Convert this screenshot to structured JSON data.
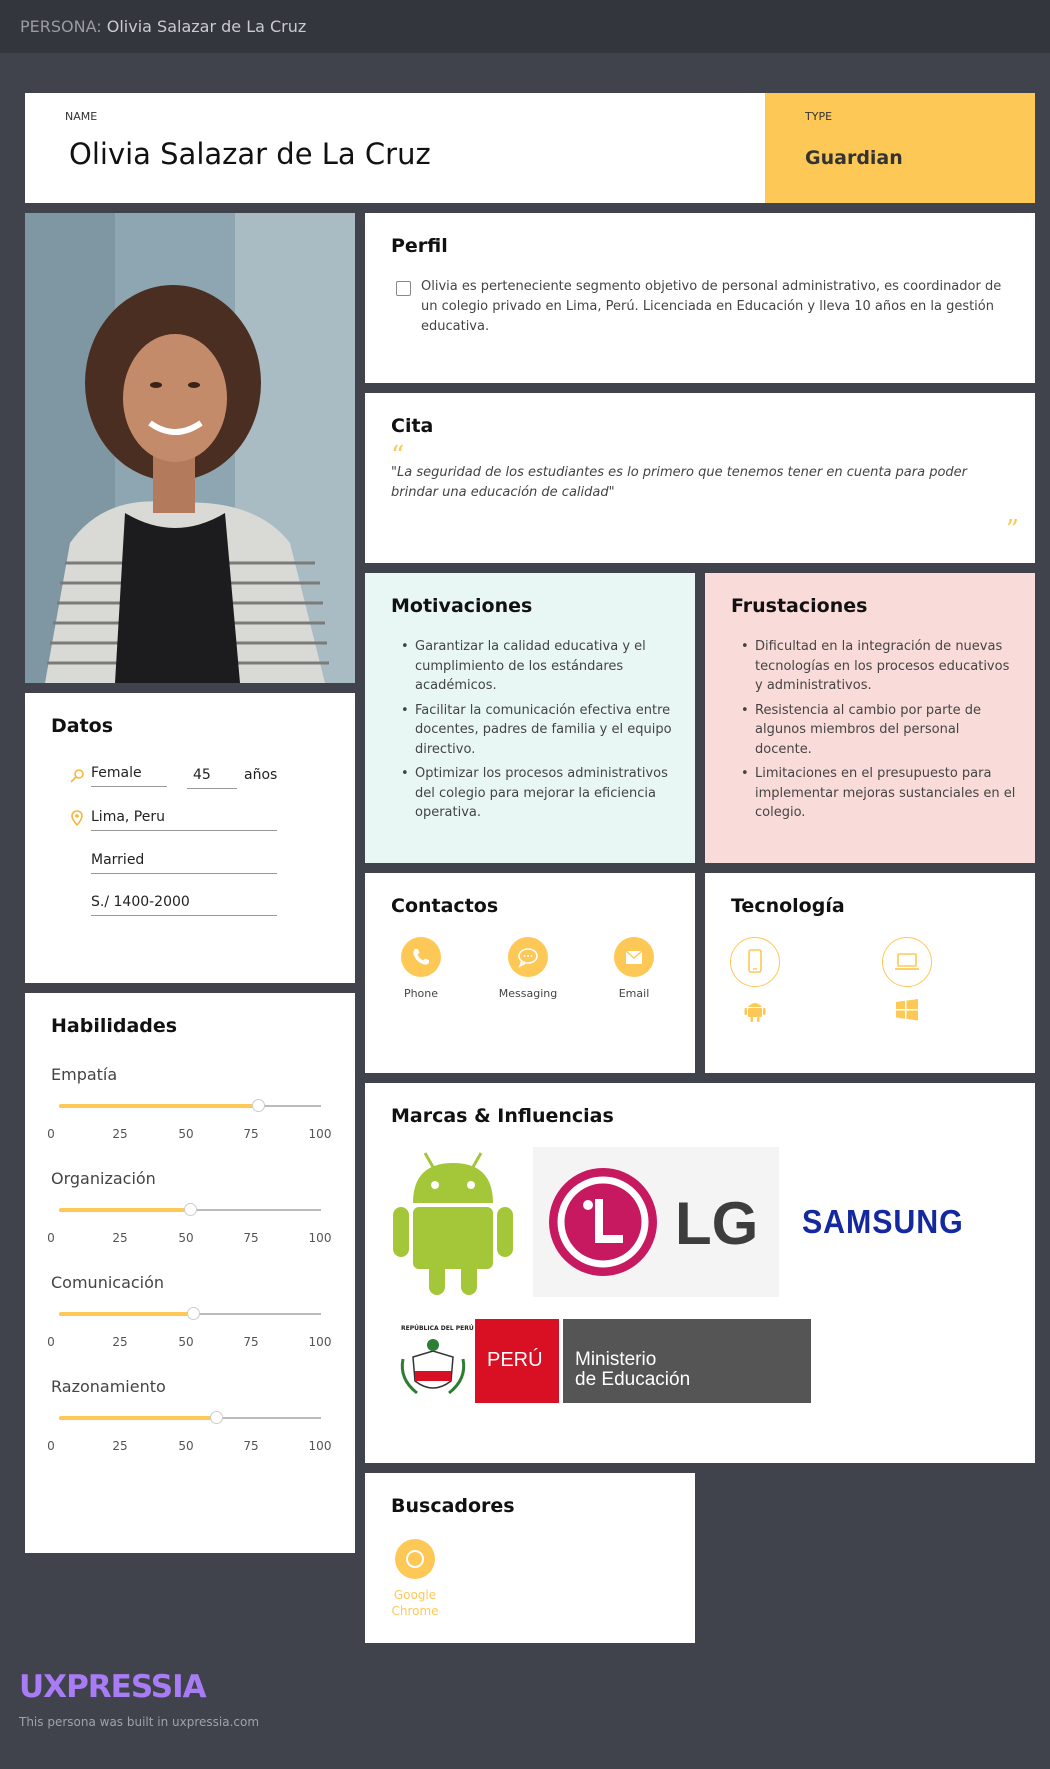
{
  "topbar": {
    "label": "PERSONA:",
    "name": "Olivia Salazar de La Cruz"
  },
  "name_block": {
    "caption": "NAME",
    "value": "Olivia Salazar de La Cruz"
  },
  "type_block": {
    "caption": "TYPE",
    "value": "Guardian"
  },
  "perfil": {
    "title": "Perfil",
    "text": "Olivia es perteneciente segmento objetivo de personal administrativo, es coordinador de un colegio privado en Lima, Perú. Licenciada en Educación y lleva 10 años en la gestión educativa."
  },
  "cita": {
    "title": "Cita",
    "quote": "\"La seguridad de los estudiantes es lo primero que tenemos tener en cuenta para poder brindar una educación de calidad\""
  },
  "motivaciones": {
    "title": "Motivaciones",
    "items": [
      "Garantizar la calidad educativa y el cumplimiento de los estándares académicos.",
      "Facilitar la comunicación efectiva entre docentes, padres de familia y el equipo directivo.",
      "Optimizar los procesos administrativos del colegio para mejorar la eficiencia operativa."
    ]
  },
  "frustraciones": {
    "title": "Frustaciones",
    "items": [
      "Dificultad en la integración de nuevas tecnologías en los procesos educativos y administrativos.",
      "Resistencia al cambio por parte de algunos miembros del personal docente.",
      "Limitaciones en el presupuesto para implementar mejoras sustanciales en el colegio."
    ]
  },
  "datos": {
    "title": "Datos",
    "gender": "Female",
    "age": "45",
    "age_unit": "años",
    "location": "Lima, Peru",
    "status": "Married",
    "income": "S./ 1400-2000"
  },
  "habilidades": {
    "title": "Habilidades",
    "ticks": [
      "0",
      "25",
      "50",
      "75",
      "100"
    ],
    "skills": [
      {
        "name": "Empatía",
        "value": 76
      },
      {
        "name": "Organización",
        "value": 50
      },
      {
        "name": "Comunicación",
        "value": 51
      },
      {
        "name": "Razonamiento",
        "value": 60
      }
    ],
    "accent_color": "#fec857"
  },
  "contactos": {
    "title": "Contactos",
    "items": [
      {
        "label": "Phone",
        "icon": "phone-icon"
      },
      {
        "label": "Messaging",
        "icon": "chat-icon"
      },
      {
        "label": "Email",
        "icon": "email-icon"
      }
    ]
  },
  "tecnologia": {
    "title": "Tecnología",
    "devices": [
      "mobile-icon",
      "laptop-icon"
    ],
    "platforms": [
      "android-icon",
      "windows-icon"
    ]
  },
  "marcas": {
    "title": "Marcas & Influencias",
    "lg_text": "LG",
    "samsung_text": "SAMSUNG",
    "peru_text": "PERÚ",
    "minedu_line1": "Ministerio",
    "minedu_line2": "de Educación",
    "seal_text": "REPÚBLICA DEL PERÚ"
  },
  "buscadores": {
    "title": "Buscadores",
    "label": "Google Chrome"
  },
  "footer": {
    "logo": "UXPRESSIA",
    "built": "This persona was built in uxpressia.com"
  },
  "colors": {
    "accent": "#fec857",
    "background": "#40434b",
    "motiv_bg": "#e8f7f3",
    "frust_bg": "#f9dcd9",
    "logo": "#a87cf4"
  }
}
